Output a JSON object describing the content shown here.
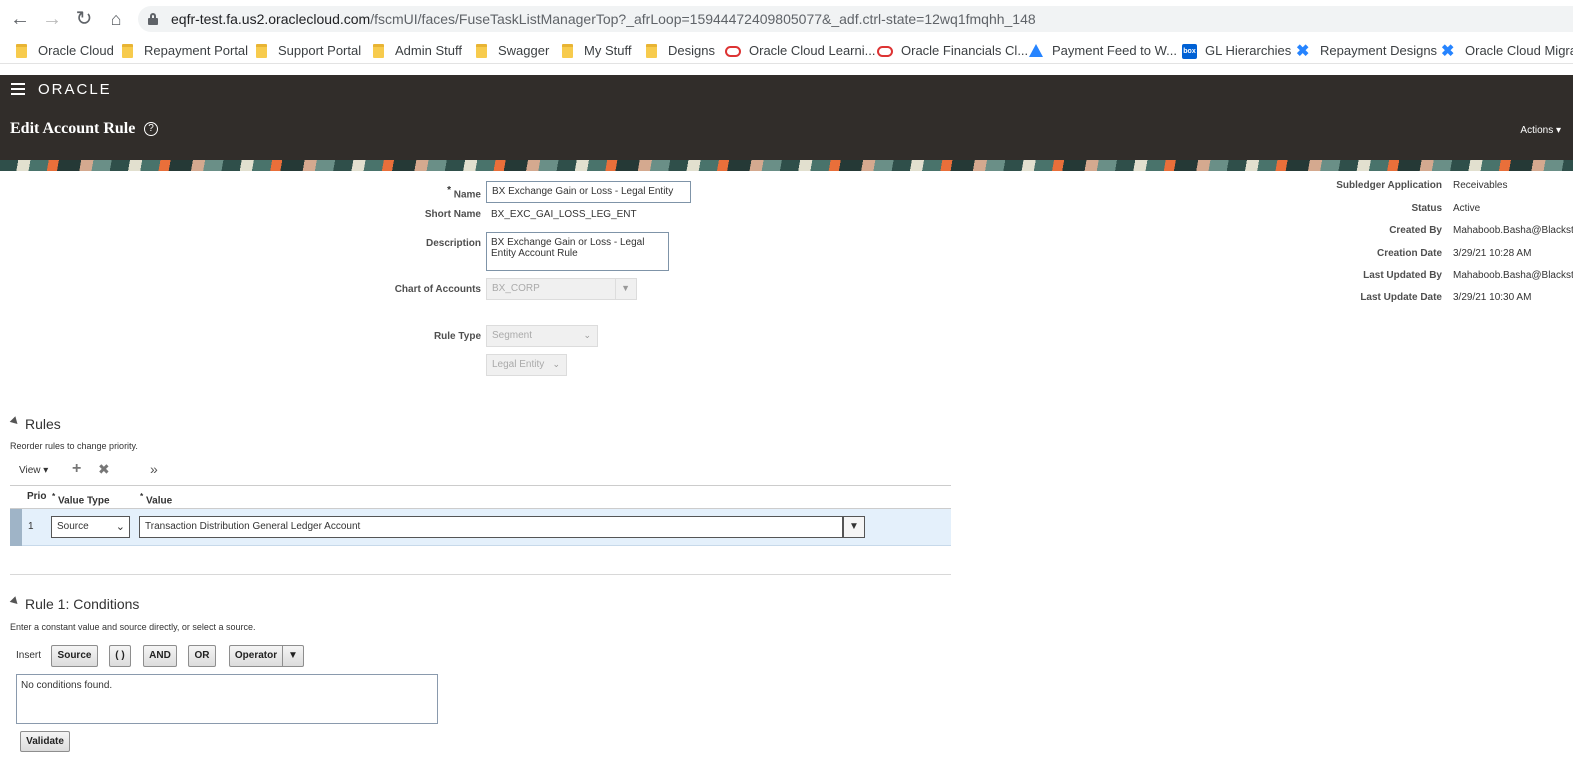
{
  "browser": {
    "url_host": "eqfr-test.fa.us2.oraclecloud.com",
    "url_path": "/fscmUI/faces/FuseTaskListManagerTop?_afrLoop=15944472409805077&_adf.ctrl-state=12wq1fmqhh_148",
    "bookmarks": [
      {
        "label": "Oracle Cloud",
        "icon": "folder-icon"
      },
      {
        "label": "Repayment Portal",
        "icon": "folder-icon"
      },
      {
        "label": "Support Portal",
        "icon": "folder-icon"
      },
      {
        "label": "Admin Stuff",
        "icon": "folder-icon"
      },
      {
        "label": "Swagger",
        "icon": "folder-icon"
      },
      {
        "label": "My Stuff",
        "icon": "folder-icon"
      },
      {
        "label": "Designs",
        "icon": "folder-icon"
      },
      {
        "label": "Oracle Cloud Learni...",
        "icon": "oracle-ring-icon"
      },
      {
        "label": "Oracle Financials Cl...",
        "icon": "oracle-ring-icon"
      },
      {
        "label": "Payment Feed to W...",
        "icon": "atlassian-icon"
      },
      {
        "label": "GL Hierarchies",
        "icon": "box-icon"
      },
      {
        "label": "Repayment Designs",
        "icon": "confluence-icon"
      },
      {
        "label": "Oracle Cloud Migra",
        "icon": "confluence-icon"
      }
    ]
  },
  "header": {
    "logo": "ORACLE",
    "title": "Edit Account Rule",
    "help": "?",
    "actions": "Actions ▾"
  },
  "form": {
    "name_label": "Name",
    "name_value": "BX Exchange Gain or Loss - Legal Entity",
    "short_name_label": "Short Name",
    "short_name_value": "BX_EXC_GAI_LOSS_LEG_ENT",
    "description_label": "Description",
    "description_value": "BX Exchange Gain or Loss - Legal Entity Account Rule",
    "coa_label": "Chart of Accounts",
    "coa_value": "BX_CORP",
    "rule_type_label": "Rule Type",
    "rule_type_value": "Segment",
    "segment_value": "Legal Entity",
    "required_mark": "*"
  },
  "info": {
    "subledger_label": "Subledger Application",
    "subledger_value": "Receivables",
    "status_label": "Status",
    "status_value": "Active",
    "created_by_label": "Created By",
    "created_by_value": "Mahaboob.Basha@Blackst",
    "creation_date_label": "Creation Date",
    "creation_date_value": "3/29/21 10:28 AM",
    "last_updated_by_label": "Last Updated By",
    "last_updated_by_value": "Mahaboob.Basha@Blackst",
    "last_update_date_label": "Last Update Date",
    "last_update_date_value": "3/29/21 10:30 AM"
  },
  "rules": {
    "title": "Rules",
    "hint": "Reorder rules to change priority.",
    "view": "View ▾",
    "more": "»",
    "columns": {
      "prio": "Prio",
      "value_type": "Value Type",
      "value": "Value"
    },
    "row": {
      "prio": "1",
      "value_type": "Source",
      "value": "Transaction Distribution General Ledger Account"
    }
  },
  "conditions": {
    "title": "Rule 1: Conditions",
    "hint": "Enter a constant value and source directly, or select a source.",
    "insert_label": "Insert",
    "source_btn": "Source",
    "paren_btn": "( )",
    "and_btn": "AND",
    "or_btn": "OR",
    "operator_btn": "Operator",
    "text": "No conditions found.",
    "validate_btn": "Validate"
  }
}
